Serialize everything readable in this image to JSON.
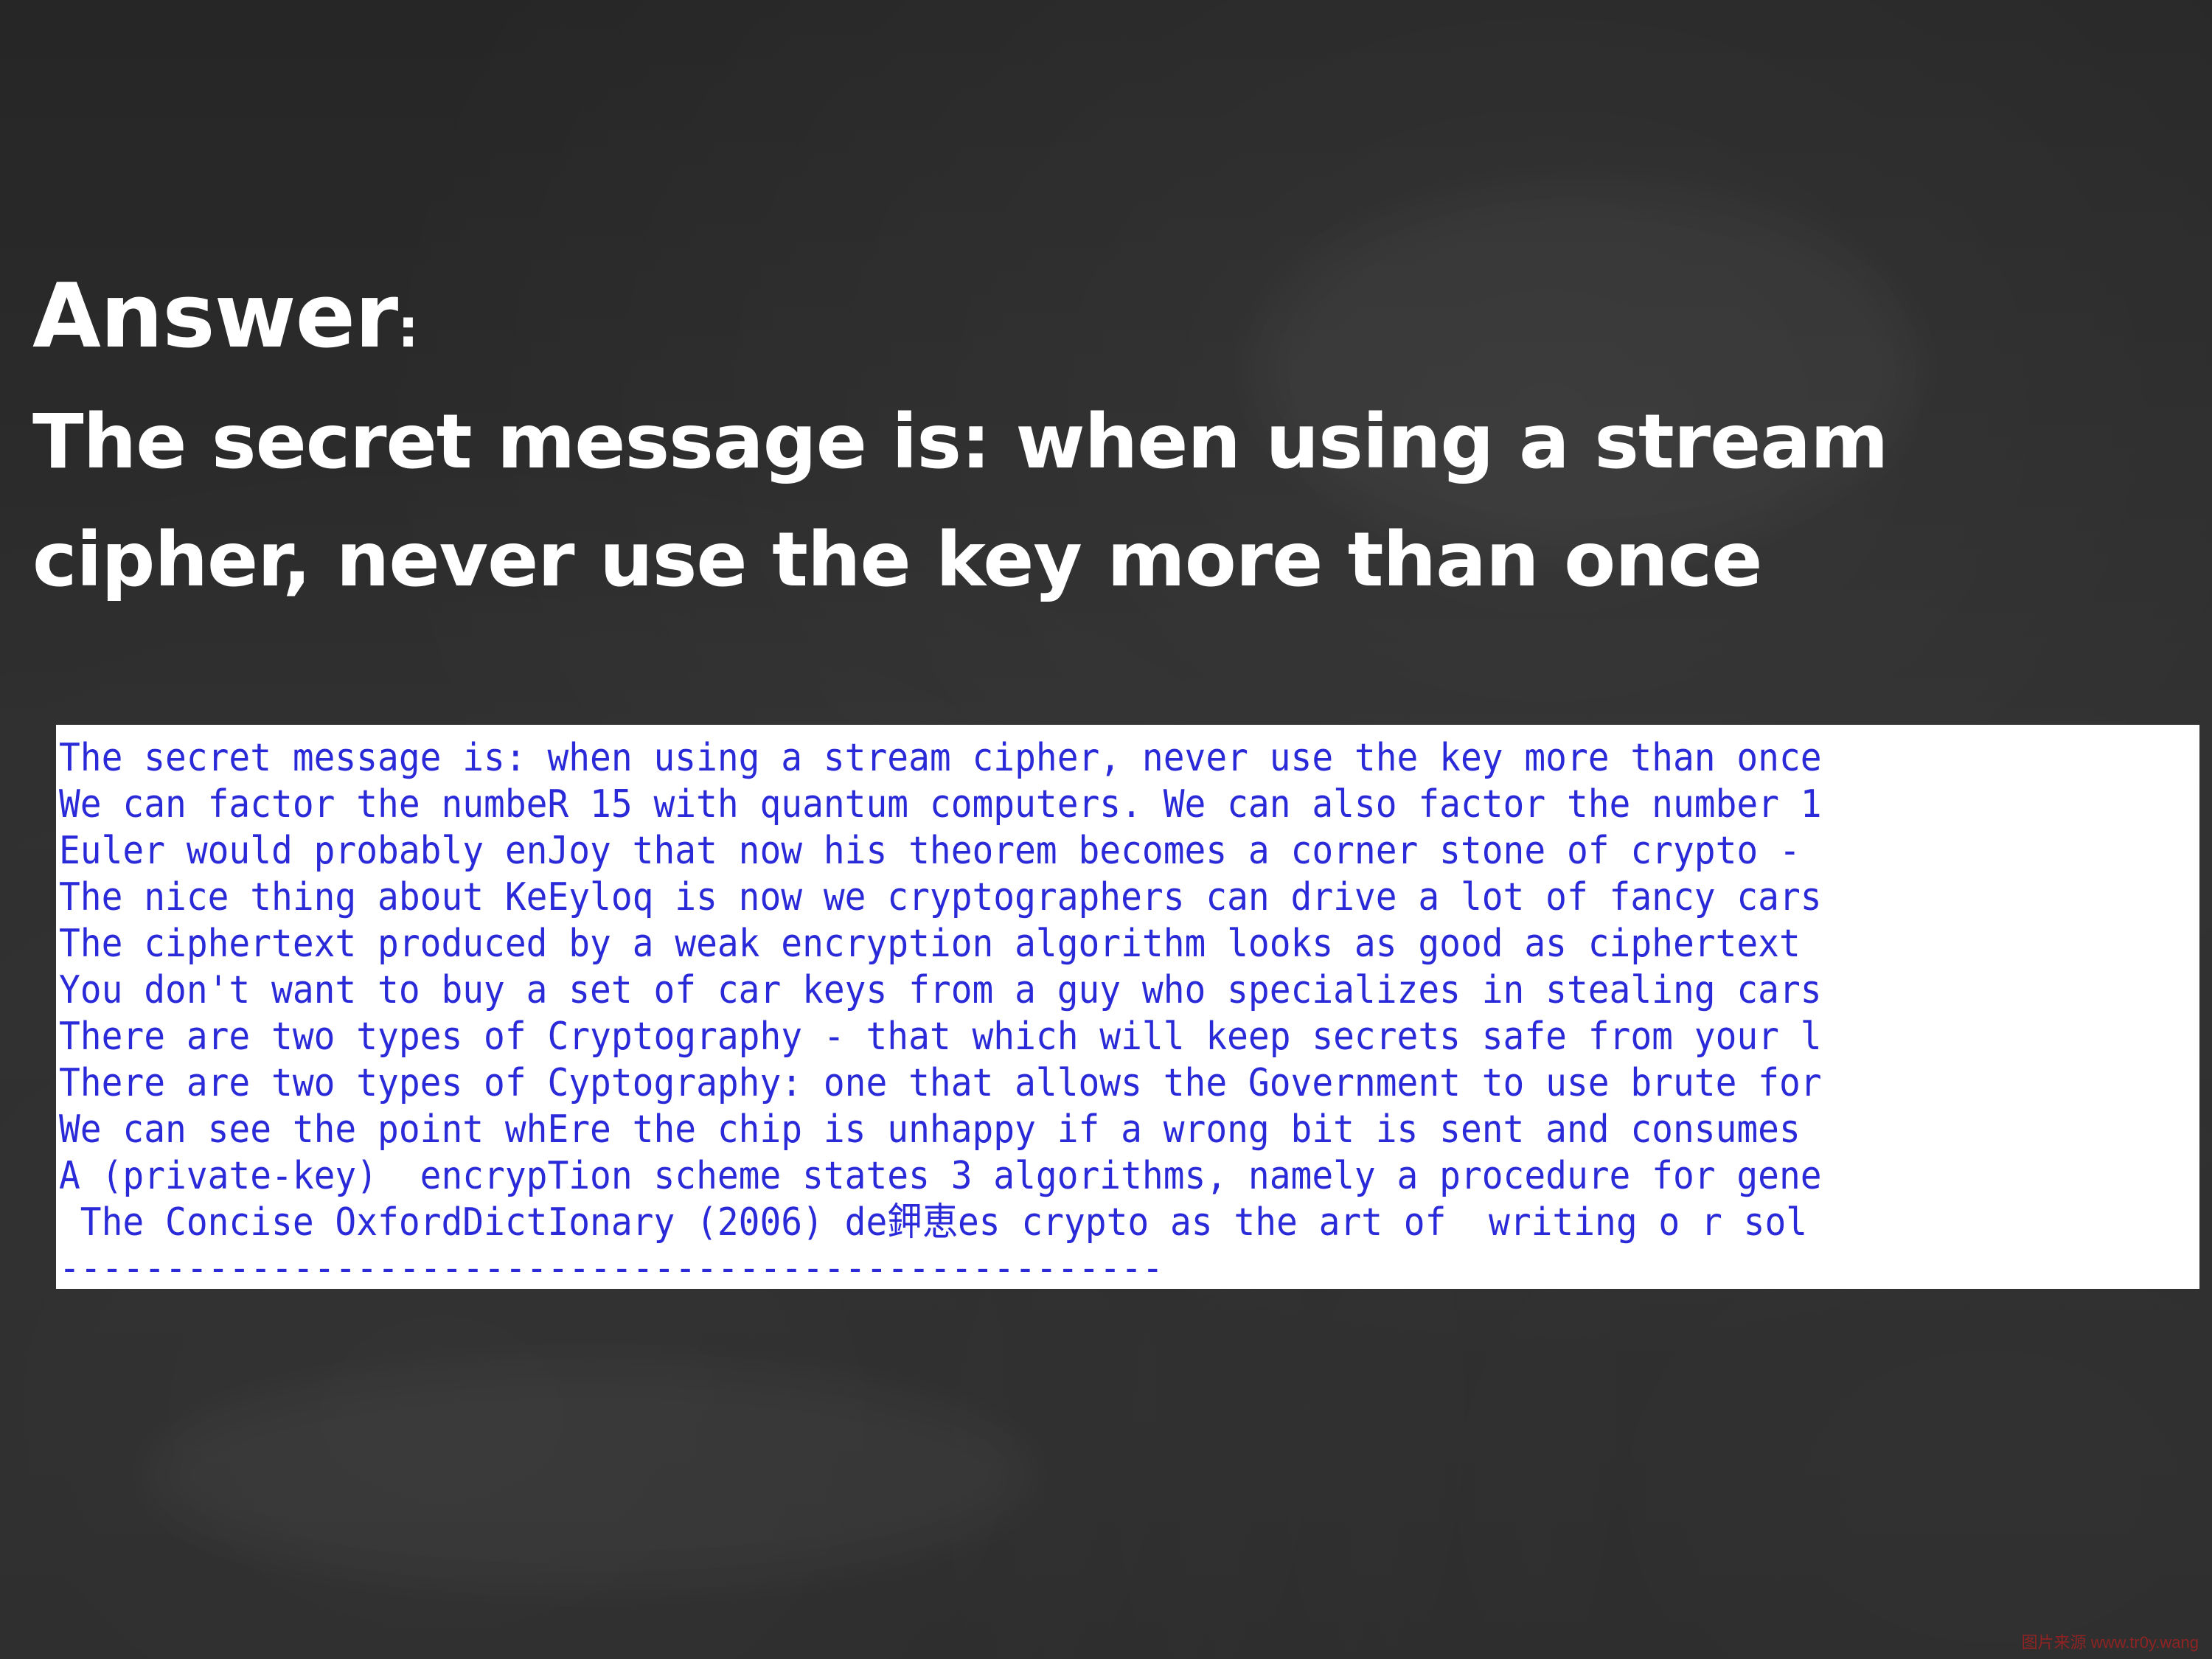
{
  "slide": {
    "answer_label": "Answer",
    "answer_colon": ":",
    "answer_text": "The secret message is: when using a stream cipher, never use the key more than once"
  },
  "panel": {
    "lines": [
      "The secret message is: when using a stream cipher, never use the key more than once",
      "We can factor the numbeR 15 with quantum computers. We can also factor the number 1",
      "Euler would probably enJoy that now his theorem becomes a corner stone of crypto -",
      "The nice thing about KeEyloq is now we cryptographers can drive a lot of fancy cars",
      "The ciphertext produced by a weak encryption algorithm looks as good as ciphertext",
      "You don't want to buy a set of car keys from a guy who specializes in stealing cars",
      "There are two types of Cryptography - that which will keep secrets safe from your l",
      "There are two types of Cyptography: one that allows the Government to use brute for",
      "We can see the point whEre the chip is unhappy if a wrong bit is sent and consumes",
      "A (private-key)  encrypTion scheme states 3 algorithms, namely a procedure for gene",
      " The Concise OxfordDictIonary (2006) de鉀恵es crypto as the art of  writing o r sol"
    ],
    "separator": "----------------------------------------------------"
  },
  "watermark": "图片来源 www.tr0y.wang",
  "colors": {
    "background": "#2b2b2b",
    "heading_text": "#ffffff",
    "panel_background": "#ffffff",
    "terminal_text": "#2a2ad8",
    "watermark": "#b02020"
  }
}
